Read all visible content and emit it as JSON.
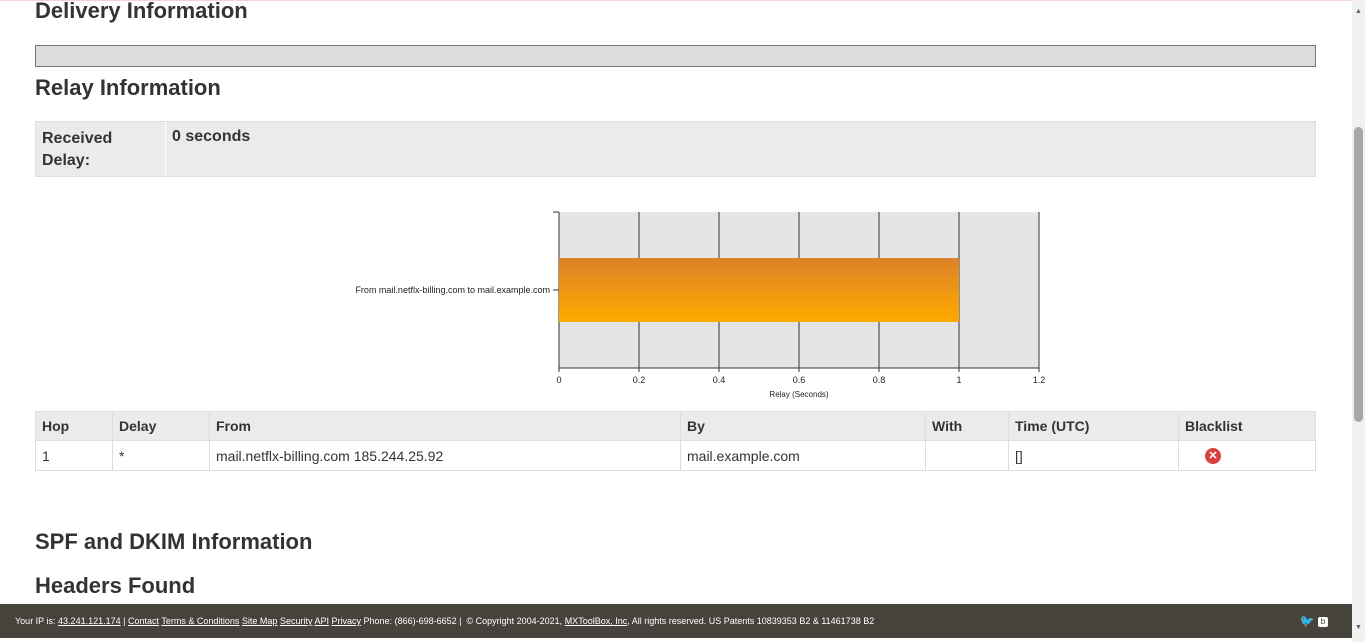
{
  "sections": {
    "delivery_title": "Delivery Information",
    "relay_title": "Relay Information",
    "spf_title": "SPF and DKIM Information",
    "headers_title": "Headers Found"
  },
  "relay": {
    "received_delay_label": "Received Delay:",
    "received_delay_value": "0 seconds"
  },
  "chart_data": {
    "type": "bar",
    "orientation": "horizontal",
    "categories": [
      "From mail.netflx-billing.com to mail.example.com"
    ],
    "values": [
      1
    ],
    "xlabel": "Relay (Seconds)",
    "ylabel": "",
    "xlim": [
      0,
      1.2
    ],
    "ticks": [
      "0",
      "0.2",
      "0.4",
      "0.6",
      "0.8",
      "1",
      "1.2"
    ],
    "grid": true,
    "bar_color_top": "#dc8228",
    "bar_color_bottom": "#ffaa00",
    "plot_bg": "#e4e5e7"
  },
  "hops_table": {
    "headers": [
      "Hop",
      "Delay",
      "From",
      "By",
      "With",
      "Time (UTC)",
      "Blacklist"
    ],
    "rows": [
      {
        "hop": "1",
        "delay": "*",
        "from": "mail.netflx-billing.com 185.244.25.92",
        "by": "mail.example.com",
        "with": "",
        "time": "[]",
        "blacklist_icon": "x-circle-icon"
      }
    ]
  },
  "footer": {
    "ip_label": "Your IP is:",
    "ip": "43.241.121.174",
    "sep1": "|",
    "contact": "Contact",
    "terms": "Terms & Conditions",
    "sitemap": "Site Map",
    "security": "Security",
    "api": "API",
    "privacy": "Privacy",
    "phone": "Phone: (866)-698-6652 |",
    "copyright": "© Copyright 2004-2021,",
    "company": "MXToolBox, Inc",
    "rights": ", All rights reserved. US Patents 10839353 B2 & 11461738 B2",
    "icons": [
      "twitter-icon",
      "blog-icon"
    ]
  },
  "colors": {
    "accent_error": "#d9413e",
    "footer_bg": "#46433c"
  }
}
